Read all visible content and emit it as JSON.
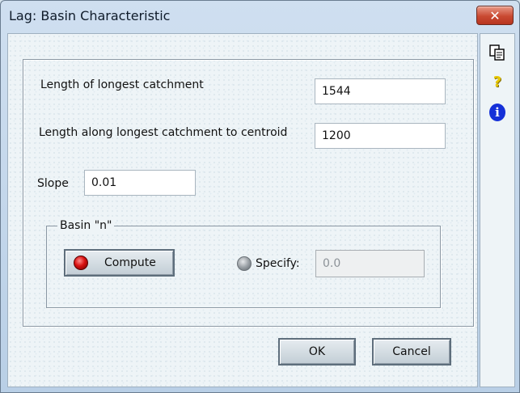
{
  "window": {
    "title": "Lag: Basin Characteristic",
    "close_glyph": "✕"
  },
  "side_tools": [
    {
      "icon": "copy-icon"
    },
    {
      "icon": "help-icon",
      "glyph": "?"
    },
    {
      "icon": "info-icon",
      "glyph": "i"
    }
  ],
  "form": {
    "length_longest_label": "Length of longest catchment",
    "length_longest_value": "1544",
    "length_centroid_label": "Length along longest catchment to centroid",
    "length_centroid_value": "1200",
    "slope_label": "Slope",
    "slope_value": "0.01"
  },
  "basin_n": {
    "group_label": "Basin \"n\"",
    "compute_label": "Compute",
    "compute_selected": true,
    "specify_label": "Specify:",
    "specify_value": "0.0",
    "specify_selected": false
  },
  "buttons": {
    "ok_label": "OK",
    "cancel_label": "Cancel"
  },
  "colors": {
    "compute_led": "#d81010",
    "specify_led": "#9aa0a5",
    "info_icon": "#1530d8",
    "help_icon": "#e8c800"
  }
}
